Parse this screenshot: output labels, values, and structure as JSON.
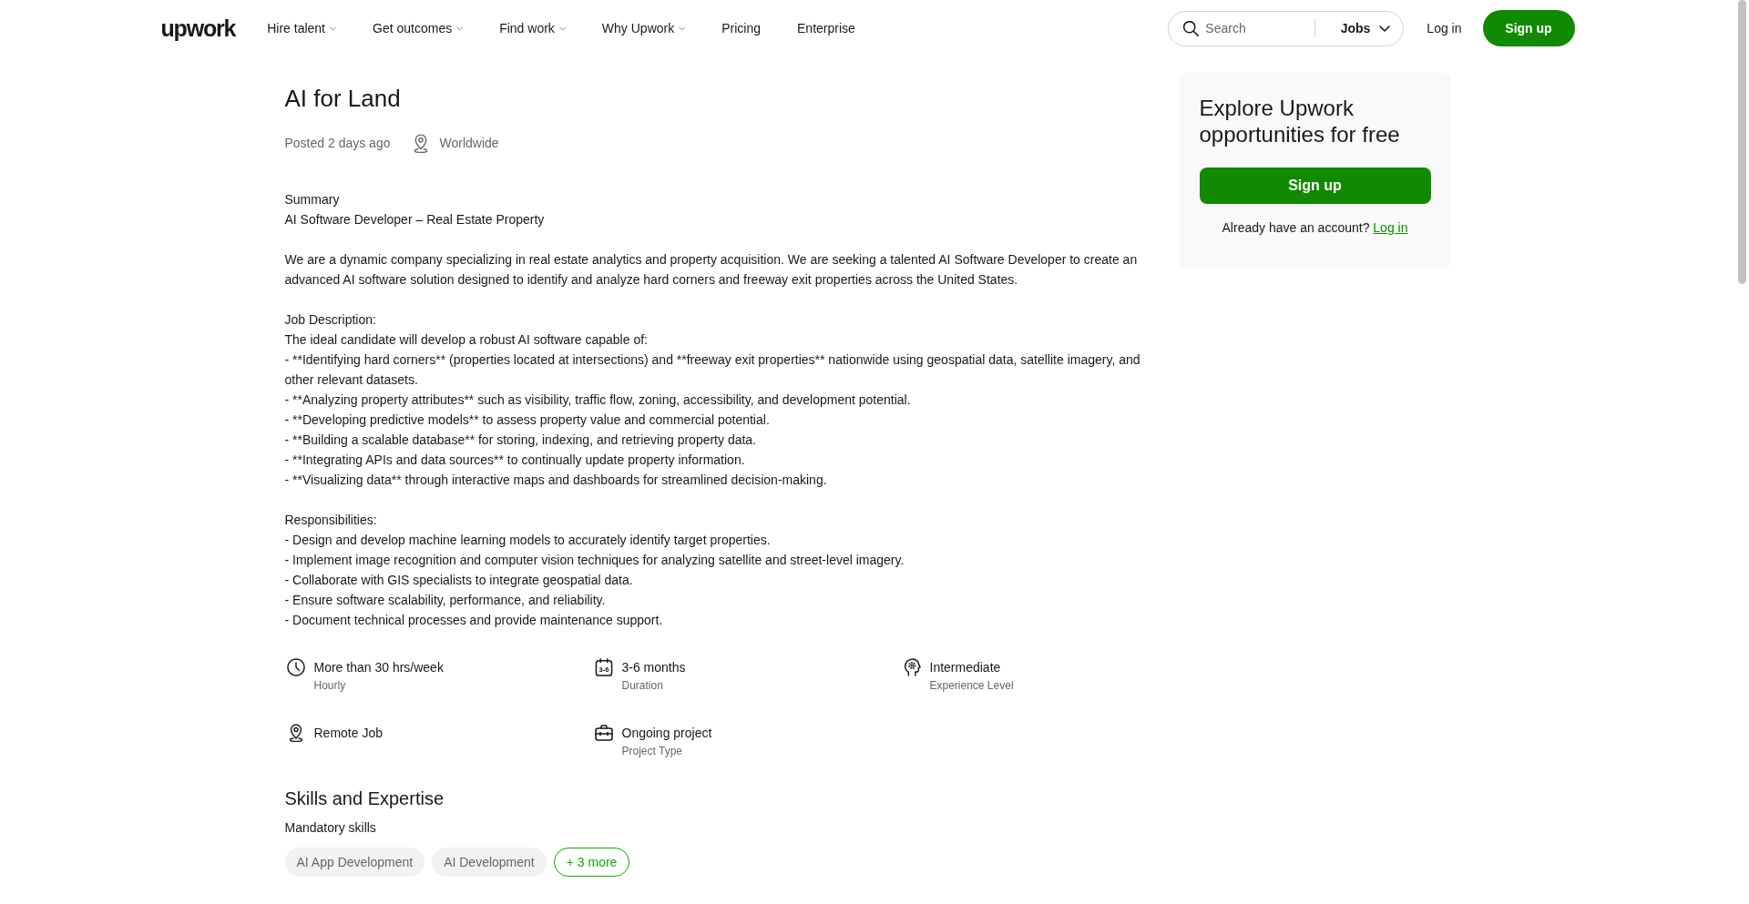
{
  "header": {
    "logo": "upwork",
    "nav": [
      {
        "label": "Hire talent",
        "has_menu": true
      },
      {
        "label": "Get outcomes",
        "has_menu": true
      },
      {
        "label": "Find work",
        "has_menu": true
      },
      {
        "label": "Why Upwork",
        "has_menu": true
      },
      {
        "label": "Pricing",
        "has_menu": false
      },
      {
        "label": "Enterprise",
        "has_menu": false
      }
    ],
    "search": {
      "placeholder": "Search",
      "scope": "Jobs"
    },
    "login": "Log in",
    "signup": "Sign up"
  },
  "job": {
    "title": "AI for Land",
    "posted": "Posted 2 days ago",
    "location": "Worldwide",
    "description": {
      "title": "Summary",
      "blocks": [
        [
          "AI Software Developer – Real Estate Property"
        ],
        [
          "We are a dynamic company specializing in real estate analytics and property acquisition. We are seeking a talented AI Software Developer to create an advanced AI software solution designed to identify and analyze hard corners and freeway exit properties across the United States."
        ],
        [
          "Job Description:",
          "The ideal candidate will develop a robust AI software capable of:",
          "- **Identifying hard corners** (properties located at intersections) and **freeway exit properties** nationwide using geospatial data, satellite imagery, and other relevant datasets.",
          "- **Analyzing property attributes** such as visibility, traffic flow, zoning, accessibility, and development potential.",
          "- **Developing predictive models** to assess property value and commercial potential.",
          "- **Building a scalable database** for storing, indexing, and retrieving property data.",
          "- **Integrating APIs and data sources** to continually update property information.",
          "- **Visualizing data** through interactive maps and dashboards for streamlined decision-making."
        ],
        [
          "Responsibilities:",
          "- Design and develop machine learning models to accurately identify target properties.",
          "- Implement image recognition and computer vision techniques for analyzing satellite and street-level imagery.",
          "- Collaborate with GIS specialists to integrate geospatial data.",
          "- Ensure software scalability, performance, and reliability.",
          "- Document technical processes and provide maintenance support."
        ]
      ]
    },
    "details": [
      {
        "kind": "clock",
        "title": "More than 30 hrs/week",
        "subtitle": "Hourly"
      },
      {
        "kind": "calendar",
        "icon_label": "3-6",
        "title": "3-6 months",
        "subtitle": "Duration"
      },
      {
        "kind": "experience",
        "title": "Intermediate",
        "subtitle": "Experience Level"
      },
      {
        "kind": "pin",
        "title": "Remote Job"
      },
      {
        "kind": "briefcase",
        "title": "Ongoing project",
        "subtitle": "Project Type"
      }
    ],
    "skills": {
      "title": "Skills and Expertise",
      "subtitle": "Mandatory skills",
      "items": [
        "AI App Development",
        "AI Development"
      ],
      "more": "+ 3 more"
    }
  },
  "sidebar": {
    "title": "Explore Upwork opportunities for free",
    "signup": "Sign up",
    "prompt": "Already have an account?",
    "login": "Log in"
  }
}
